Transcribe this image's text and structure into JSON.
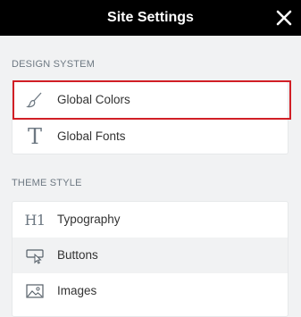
{
  "header": {
    "title": "Site Settings",
    "close_icon": "close-icon"
  },
  "design_system": {
    "title": "DESIGN SYSTEM",
    "items": [
      {
        "label": "Global Colors",
        "icon": "brush-icon",
        "highlighted": true
      },
      {
        "label": "Global Fonts",
        "icon": "typeface-t-icon"
      }
    ]
  },
  "theme_style": {
    "title": "THEME STYLE",
    "items": [
      {
        "label": "Typography",
        "icon": "h1-icon",
        "glyph": "H1"
      },
      {
        "label": "Buttons",
        "icon": "button-cursor-icon",
        "hovered": true
      },
      {
        "label": "Images",
        "icon": "image-icon"
      }
    ]
  },
  "colors": {
    "header_bg": "#000000",
    "highlight_border": "#d11f26",
    "panel_bg": "#f1f2f3",
    "card_bg": "#ffffff"
  }
}
